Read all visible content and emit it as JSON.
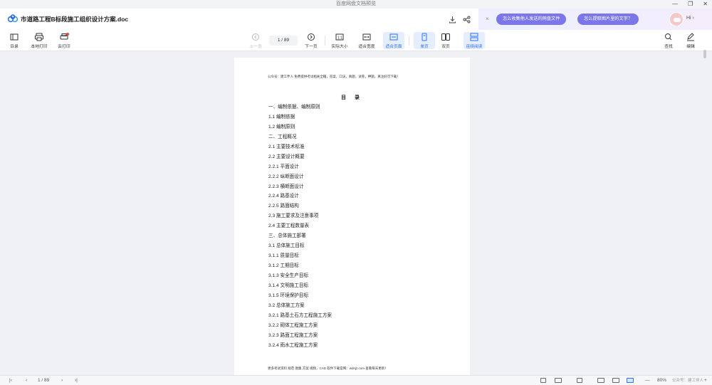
{
  "window": {
    "title": "百度网盘文档预览",
    "controls": {
      "minimize": "—",
      "restore": "❐",
      "close": "✕"
    }
  },
  "header": {
    "doc_title": "市道路工程B标段施工组织设计方案.doc",
    "icons": [
      "download-icon",
      "share-icon"
    ]
  },
  "assistant": {
    "close": "×",
    "suggestions": [
      "怎么收集他人发送的网盘文件",
      "怎么提取图片里的文字？"
    ],
    "greeting": "Hi ›"
  },
  "toolbar": {
    "left": [
      {
        "label": "目录",
        "icon": "toc-icon"
      },
      {
        "label": "本地打印",
        "icon": "printer-icon"
      },
      {
        "label": "云打印",
        "icon": "cloud-print-icon"
      }
    ],
    "prev_page": "上一页",
    "page_indicator": "1 / 89",
    "next_page": "下一页",
    "view": [
      {
        "label": "实际大小",
        "icon": "actual-size-icon",
        "active": false
      },
      {
        "label": "适合宽度",
        "icon": "fit-width-icon",
        "active": false
      },
      {
        "label": "适合页面",
        "icon": "fit-page-icon",
        "active": true
      },
      {
        "label": "单页",
        "icon": "single-page-icon",
        "active": true
      },
      {
        "label": "双页",
        "icon": "double-page-icon",
        "active": false
      },
      {
        "label": "连续阅读",
        "icon": "continuous-read-icon",
        "active": true
      }
    ],
    "right": [
      {
        "label": "查找",
        "icon": "search-icon"
      },
      {
        "label": "编辑",
        "icon": "edit-icon"
      }
    ]
  },
  "page": {
    "header_text": "公众号：建工伴人 免费提供考试相关全籍，答案，口诀，真题，试卷，押题，真注好可下载！",
    "toc_title": "目 录",
    "toc": [
      "一、编制依据、编制原则",
      "1.1 编制依据",
      "1.2 编制原则",
      "二、工程概况",
      "2.1 主要技术标准",
      "2.2 主要设计概要",
      "2.2.1 平面设计",
      "2.2.2 纵断面设计",
      "2.2.3 横断面设计",
      "2.2.4 路基设计",
      "2.2.5 路面结构",
      "2.3 施工要求及注意事项",
      "2.4 主要工程数量表",
      "三、总体施工部署",
      "3.1 总体施工目标",
      "3.1.1 质量目标",
      "3.1.2 工期目标",
      "3.1.3 安全生产目标",
      "3.1.4 文明施工目标",
      "3.1.5 环境保护目标",
      "3.2 总体施工方案",
      "3.2.1 路基土石方工程施工方案",
      "3.2.2 砌体工程施工方案",
      "3.2.3 路面工程施工方案",
      "3.2.4 雨水工程施工方案"
    ],
    "footer_text": "更多考试资料 规范 图集 方案 视频，CAD 软件下载官网：wdnjz.com 查看每天更新！"
  },
  "bottombar": {
    "first": "|‹",
    "prev": "‹",
    "page_indicator": "1 / 89",
    "next": "›",
    "last": "›|",
    "zoom_minus": "—",
    "zoom": "80%",
    "zoom_plus": "+",
    "watermark": "公众号：建工伴人"
  },
  "colors": {
    "accent": "#2e6df5",
    "pill": "#7b77ea",
    "background": "#f0f1f4"
  }
}
